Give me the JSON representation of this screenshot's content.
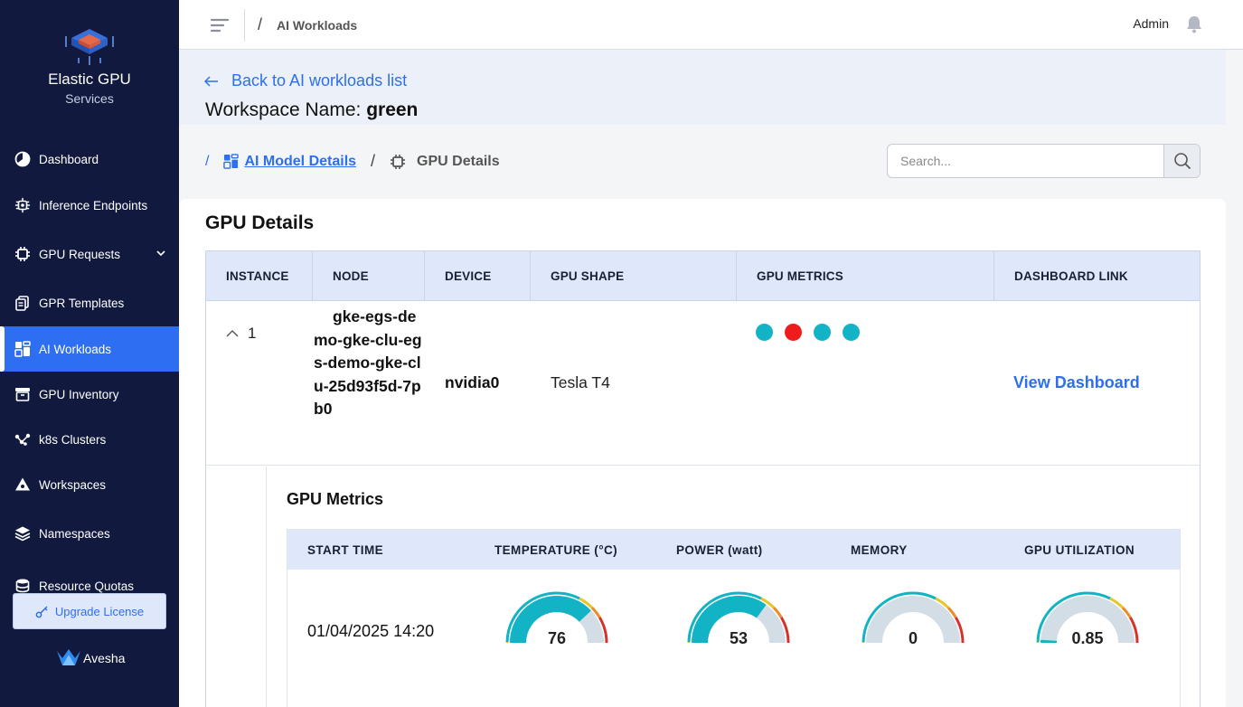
{
  "brand": {
    "title": "Elastic GPU",
    "subtitle": "Services"
  },
  "sidebar": {
    "items": [
      {
        "label": "Dashboard",
        "icon": "pie-chart-icon"
      },
      {
        "label": "Inference Endpoints",
        "icon": "gear-chip-icon"
      },
      {
        "label": "GPU Requests",
        "icon": "chip-icon"
      },
      {
        "label": "GPR Templates",
        "icon": "copy-icon"
      },
      {
        "label": "AI Workloads",
        "icon": "grid-icon"
      },
      {
        "label": "GPU Inventory",
        "icon": "archive-icon"
      },
      {
        "label": "k8s Clusters",
        "icon": "network-icon"
      },
      {
        "label": "Workspaces",
        "icon": "triangle-icon"
      },
      {
        "label": "Namespaces",
        "icon": "layers-icon"
      },
      {
        "label": "Resource Quotas",
        "icon": "database-icon"
      }
    ],
    "upgrade_label": "Upgrade License",
    "footer_brand": "Avesha"
  },
  "topbar": {
    "breadcrumb": "AI Workloads",
    "user": "Admin"
  },
  "header": {
    "back_label": "Back to AI workloads list",
    "workspace_label": "Workspace Name:",
    "workspace_value": "green"
  },
  "breadcrumbs": {
    "model_details": "AI Model Details",
    "current": "GPU Details"
  },
  "search": {
    "placeholder": "Search..."
  },
  "main": {
    "title": "GPU Details",
    "columns": [
      "INSTANCE",
      "NODE",
      "DEVICE",
      "GPU SHAPE",
      "GPU METRICS",
      "DASHBOARD LINK"
    ],
    "row": {
      "instance": "1",
      "node": "gke-egs-demo-gke-clu-egs-demo-gke-clu-25d93f5d-7pb0",
      "device": "nvidia0",
      "shape": "Tesla T4",
      "metric_dots": [
        "#12b3c4",
        "#ee1c1c",
        "#12b3c4",
        "#12b3c4"
      ],
      "dashboard_link": "View Dashboard"
    }
  },
  "metrics": {
    "title": "GPU Metrics",
    "columns": [
      "START TIME",
      "TEMPERATURE (°C)",
      "POWER (watt)",
      "MEMORY",
      "GPU UTILIZATION"
    ],
    "start_time": "01/04/2025 14:20",
    "gauges": [
      {
        "name": "temperature",
        "value": "76",
        "fraction": 0.76
      },
      {
        "name": "power",
        "value": "53",
        "fraction": 0.7
      },
      {
        "name": "memory",
        "value": "0",
        "fraction": 0.0
      },
      {
        "name": "gpu-utilization",
        "value": "0.85",
        "fraction": 0.02
      }
    ]
  },
  "colors": {
    "sidebar_bg": "#111a3e",
    "accent": "#2d6ff0",
    "gauge_fill": "#12b3c4",
    "gauge_track": "#d3dde6"
  }
}
